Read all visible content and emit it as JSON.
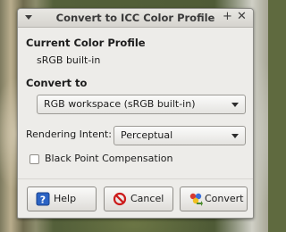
{
  "dialog": {
    "title": "Convert to ICC Color Profile",
    "current_profile_heading": "Current Color Profile",
    "current_profile_value": "sRGB built-in",
    "convert_to_heading": "Convert to",
    "convert_to_selected": "RGB workspace (sRGB built-in)",
    "rendering_intent_label": "Rendering Intent:",
    "rendering_intent_selected": "Perceptual",
    "black_point_label": "Black Point Compensation",
    "black_point_checked": false
  },
  "buttons": {
    "help": "Help",
    "cancel": "Cancel",
    "convert": "Convert"
  },
  "icons": {
    "titlebar_menu": "menu-arrow-icon",
    "pin": "pin-icon",
    "close": "close-icon",
    "help": "help-icon",
    "cancel": "cancel-icon",
    "convert": "convert-icon"
  },
  "colors": {
    "window_bg": "#edece9",
    "help_icon": "#2b63c4",
    "cancel_icon": "#cc1a1a"
  }
}
